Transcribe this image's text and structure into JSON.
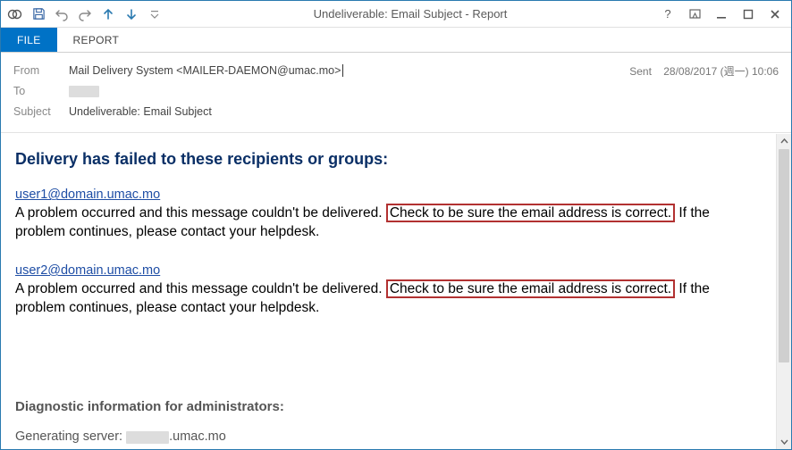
{
  "window": {
    "title": "Undeliverable: Email Subject - Report"
  },
  "ribbon": {
    "file": "FILE",
    "report": "REPORT"
  },
  "header": {
    "from_label": "From",
    "from_value": "Mail Delivery System <MAILER-DAEMON@umac.mo>",
    "to_label": "To",
    "subject_label": "Subject",
    "subject_value": "Undeliverable: Email Subject",
    "sent_label": "Sent",
    "sent_value": "28/08/2017 (週一) 10:06"
  },
  "body": {
    "fail_heading": "Delivery has failed to these recipients or groups:",
    "recipients": [
      {
        "email": "user1@domain.umac.mo",
        "msg_pre": "A problem occurred and this message couldn't be delivered. ",
        "msg_hl": "Check to be sure the email address is correct.",
        "msg_post": " If the problem continues, please contact your helpdesk."
      },
      {
        "email": "user2@domain.umac.mo",
        "msg_pre": "A problem occurred and this message couldn't be delivered. ",
        "msg_hl": "Check to be sure the email address is correct.",
        "msg_post": " If the problem continues, please contact your helpdesk."
      }
    ],
    "diag_head": "Diagnostic information for administrators:",
    "gen_server_label": "Generating server: ",
    "gen_server_suffix": ".umac.mo"
  }
}
